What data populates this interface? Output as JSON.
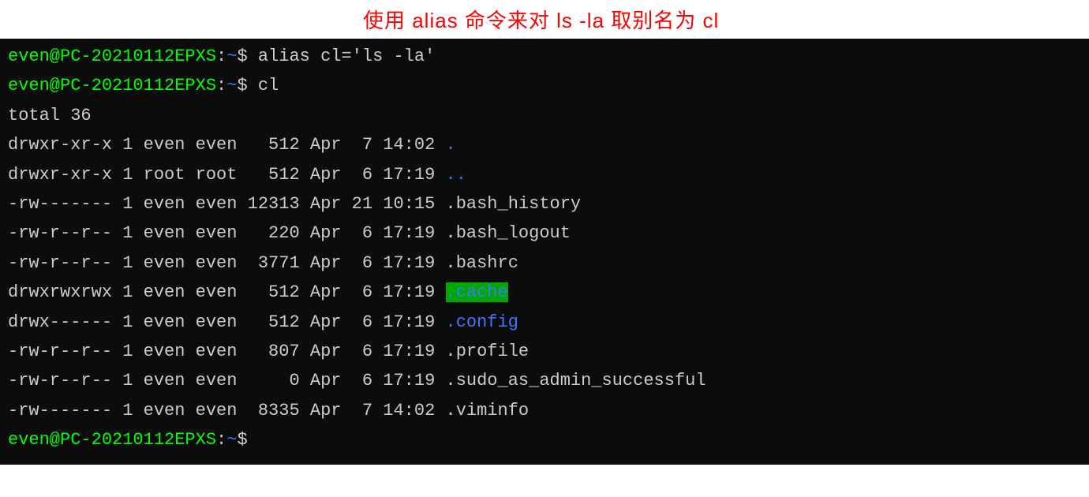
{
  "annotation": "使用 alias 命令来对 ls -la  取别名为  cl",
  "prompt": {
    "user_host": "even@PC-20210112EPXS",
    "sep": ":",
    "path": "~",
    "symbol": "$"
  },
  "commands": {
    "cmd1": "alias cl='ls -la'",
    "cmd2": "cl"
  },
  "output": {
    "total": "total 36",
    "rows": [
      {
        "perm": "drwxr-xr-x",
        "links": "1",
        "owner": "even",
        "group": "even",
        "size": "  512",
        "date": "Apr  7 14:02",
        "name": ".",
        "type": "dir"
      },
      {
        "perm": "drwxr-xr-x",
        "links": "1",
        "owner": "root",
        "group": "root",
        "size": "  512",
        "date": "Apr  6 17:19",
        "name": "..",
        "type": "dir"
      },
      {
        "perm": "-rw-------",
        "links": "1",
        "owner": "even",
        "group": "even",
        "size": "12313",
        "date": "Apr 21 10:15",
        "name": ".bash_history",
        "type": "file"
      },
      {
        "perm": "-rw-r--r--",
        "links": "1",
        "owner": "even",
        "group": "even",
        "size": "  220",
        "date": "Apr  6 17:19",
        "name": ".bash_logout",
        "type": "file"
      },
      {
        "perm": "-rw-r--r--",
        "links": "1",
        "owner": "even",
        "group": "even",
        "size": " 3771",
        "date": "Apr  6 17:19",
        "name": ".bashrc",
        "type": "file"
      },
      {
        "perm": "drwxrwxrwx",
        "links": "1",
        "owner": "even",
        "group": "even",
        "size": "  512",
        "date": "Apr  6 17:19",
        "name": ".cache",
        "type": "sticky"
      },
      {
        "perm": "drwx------",
        "links": "1",
        "owner": "even",
        "group": "even",
        "size": "  512",
        "date": "Apr  6 17:19",
        "name": ".config",
        "type": "dir"
      },
      {
        "perm": "-rw-r--r--",
        "links": "1",
        "owner": "even",
        "group": "even",
        "size": "  807",
        "date": "Apr  6 17:19",
        "name": ".profile",
        "type": "file"
      },
      {
        "perm": "-rw-r--r--",
        "links": "1",
        "owner": "even",
        "group": "even",
        "size": "    0",
        "date": "Apr  6 17:19",
        "name": ".sudo_as_admin_successful",
        "type": "file"
      },
      {
        "perm": "-rw-------",
        "links": "1",
        "owner": "even",
        "group": "even",
        "size": " 8335",
        "date": "Apr  7 14:02",
        "name": ".viminfo",
        "type": "file"
      }
    ]
  }
}
